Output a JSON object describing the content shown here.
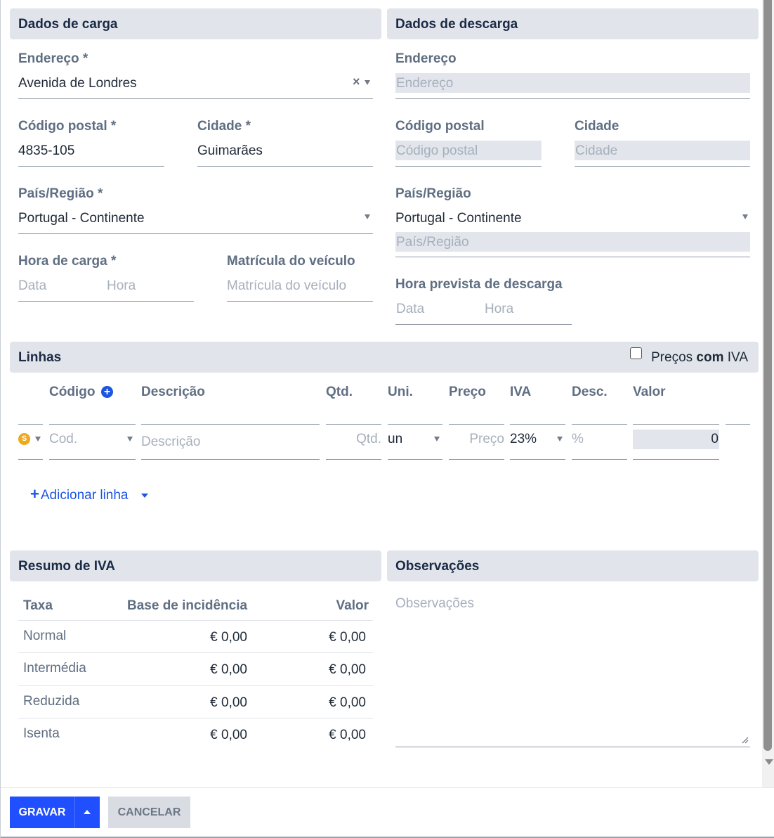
{
  "carga": {
    "title": "Dados de carga",
    "endereco_label": "Endereço *",
    "endereco_value": "Avenida de Londres",
    "clear_symbol": "×",
    "codigo_postal_label": "Código postal *",
    "codigo_postal_value": "4835-105",
    "cidade_label": "Cidade *",
    "cidade_value": "Guimarães",
    "pais_label": "País/Região *",
    "pais_value": "Portugal - Continente",
    "hora_label": "Hora de carga *",
    "data_placeholder": "Data",
    "hora_placeholder": "Hora",
    "matricula_label": "Matrícula do veículo",
    "matricula_placeholder": "Matrícula do veículo"
  },
  "descarga": {
    "title": "Dados de descarga",
    "endereco_label": "Endereço",
    "endereco_placeholder": "Endereço",
    "codigo_postal_label": "Código postal",
    "codigo_postal_placeholder": "Código postal",
    "cidade_label": "Cidade",
    "cidade_placeholder": "Cidade",
    "pais_label": "País/Região",
    "pais_value": "Portugal - Continente",
    "pais_placeholder": "País/Região",
    "hora_label": "Hora prevista de descarga",
    "data_placeholder": "Data",
    "hora_placeholder": "Hora"
  },
  "linhas": {
    "title": "Linhas",
    "precos_prefix": "Preços ",
    "precos_bold": "com",
    "precos_suffix": " IVA",
    "precos_checked": false,
    "columns": {
      "codigo": "Código",
      "descricao": "Descrição",
      "qtd": "Qtd.",
      "uni": "Uni.",
      "preco": "Preço",
      "iva": "IVA",
      "desc": "Desc.",
      "valor": "Valor"
    },
    "row": {
      "coin_symbol": "S",
      "codigo_placeholder": "Cod.",
      "descricao_placeholder": "Descrição",
      "qtd_placeholder": "Qtd.",
      "uni_value": "un",
      "preco_placeholder": "Preço",
      "iva_value": "23%",
      "desc_placeholder": "%",
      "valor_value": "0"
    },
    "add_line_label": "Adicionar linha"
  },
  "iva_summary": {
    "title": "Resumo de IVA",
    "headers": {
      "taxa": "Taxa",
      "base": "Base de incidência",
      "valor": "Valor"
    },
    "rows": [
      {
        "taxa": "Normal",
        "base": "€ 0,00",
        "valor": "€ 0,00"
      },
      {
        "taxa": "Intermédia",
        "base": "€ 0,00",
        "valor": "€ 0,00"
      },
      {
        "taxa": "Reduzida",
        "base": "€ 0,00",
        "valor": "€ 0,00"
      },
      {
        "taxa": "Isenta",
        "base": "€ 0,00",
        "valor": "€ 0,00"
      }
    ]
  },
  "observacoes": {
    "title": "Observações",
    "placeholder": "Observações"
  },
  "footer": {
    "save_label": "GRAVAR",
    "cancel_label": "CANCELAR"
  },
  "colors": {
    "accent": "#1f4fff",
    "link": "#1d55e0",
    "section_bg": "#e1e5eb",
    "coin": "#f0a81e"
  }
}
